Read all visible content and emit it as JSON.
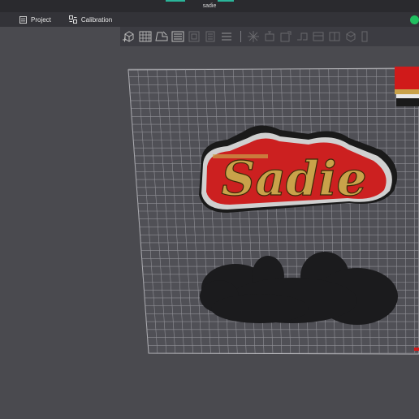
{
  "window": {
    "title": "sadie"
  },
  "menu": {
    "project_label": "Project",
    "calibration_label": "Calibration"
  },
  "status": {
    "color": "#1fbf5f"
  },
  "toolbar": {
    "icons": [
      "add-cube-icon",
      "grid-icon",
      "layout-icon",
      "list-icon",
      "cut-icon",
      "rotate-icon",
      "scale-icon",
      "mirror-icon",
      "support-icon",
      "paint-icon",
      "seam-icon",
      "text-icon",
      "measure-icon",
      "assemble-icon"
    ]
  },
  "scene": {
    "model_text": "Sadie",
    "model_colors": [
      "#c9a24a",
      "#cc2020",
      "#1a1a1a",
      "#d0d0d0"
    ]
  }
}
